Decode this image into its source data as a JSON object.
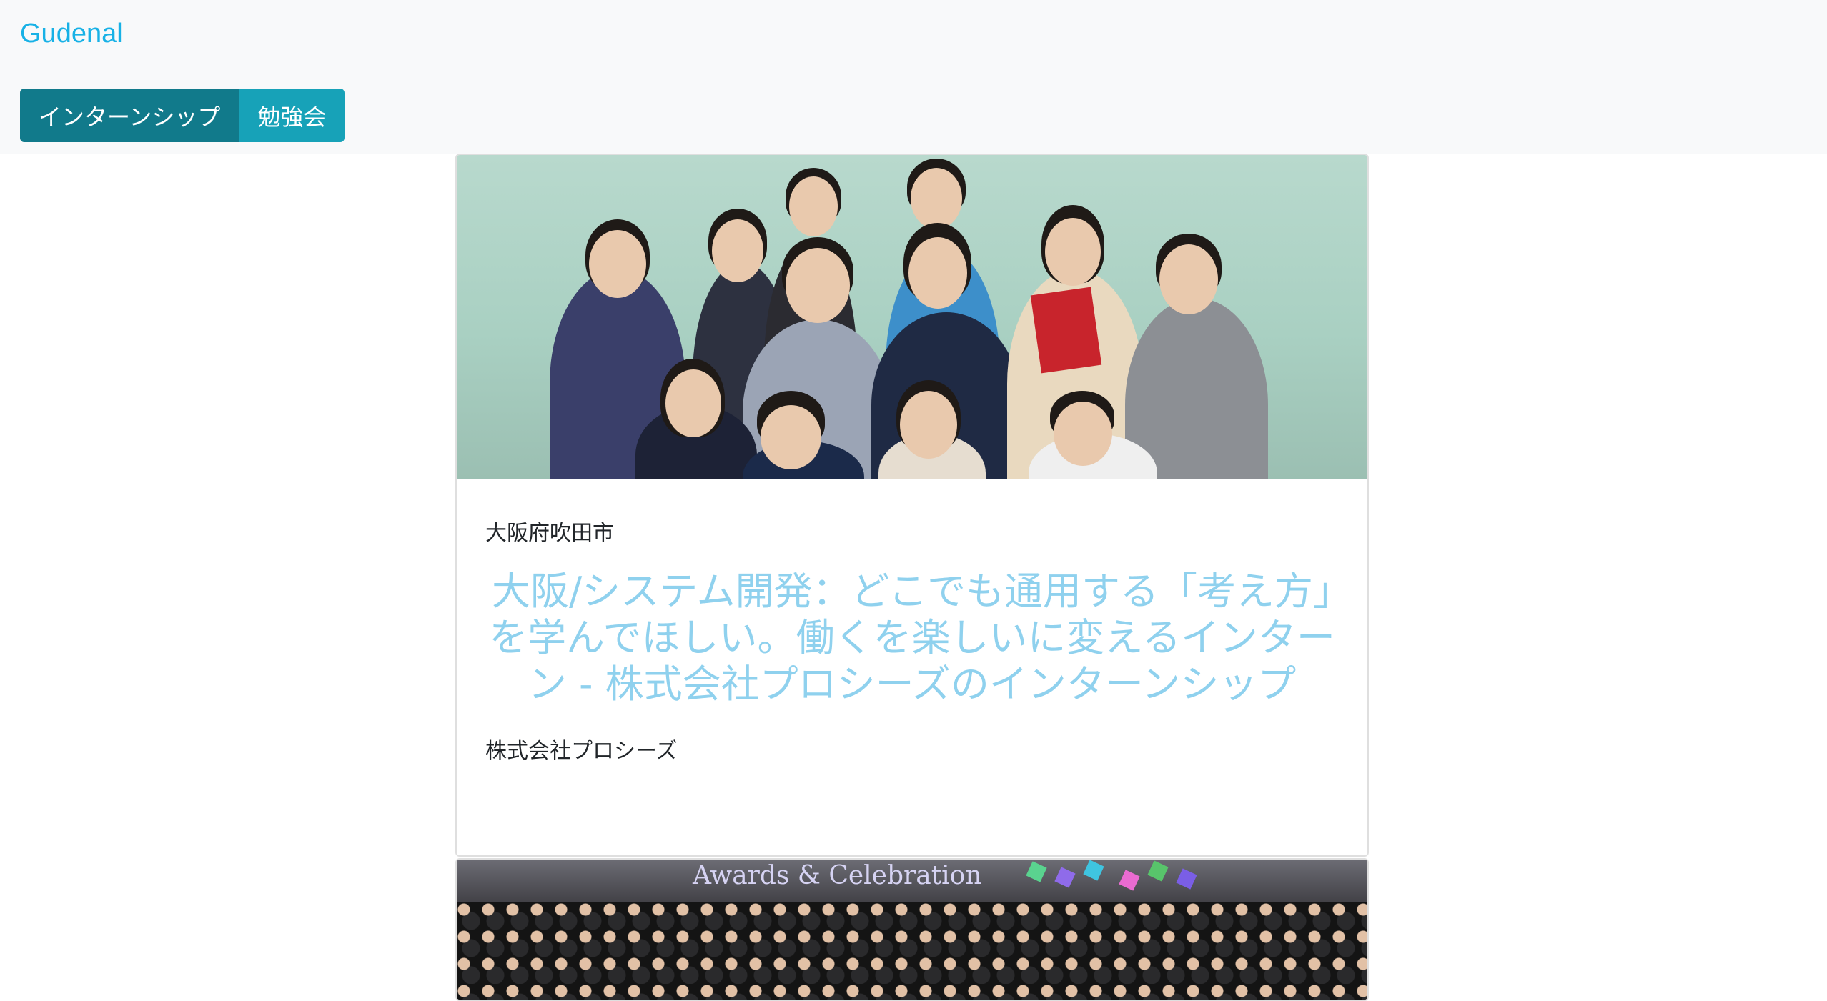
{
  "header": {
    "brand": "Gudenal",
    "tabs": [
      {
        "label": "インターンシップ",
        "active": true
      },
      {
        "label": "勉強会",
        "active": false
      }
    ]
  },
  "cards": [
    {
      "image_alt": "team-photo",
      "location": "大阪府吹田市",
      "title": "大阪/システム開発：どこでも通用する「考え方」を学んでほしい。働くを楽しいに変えるインターン - 株式会社プロシーズのインターンシップ",
      "company": "株式会社プロシーズ"
    },
    {
      "image_alt": "event-photo",
      "banner_text": "Awards & Celebration"
    }
  ],
  "colors": {
    "brand": "#17b1e6",
    "tab_active": "#117a8b",
    "tab_normal": "#17a2b8",
    "title": "#8fd1ee"
  }
}
